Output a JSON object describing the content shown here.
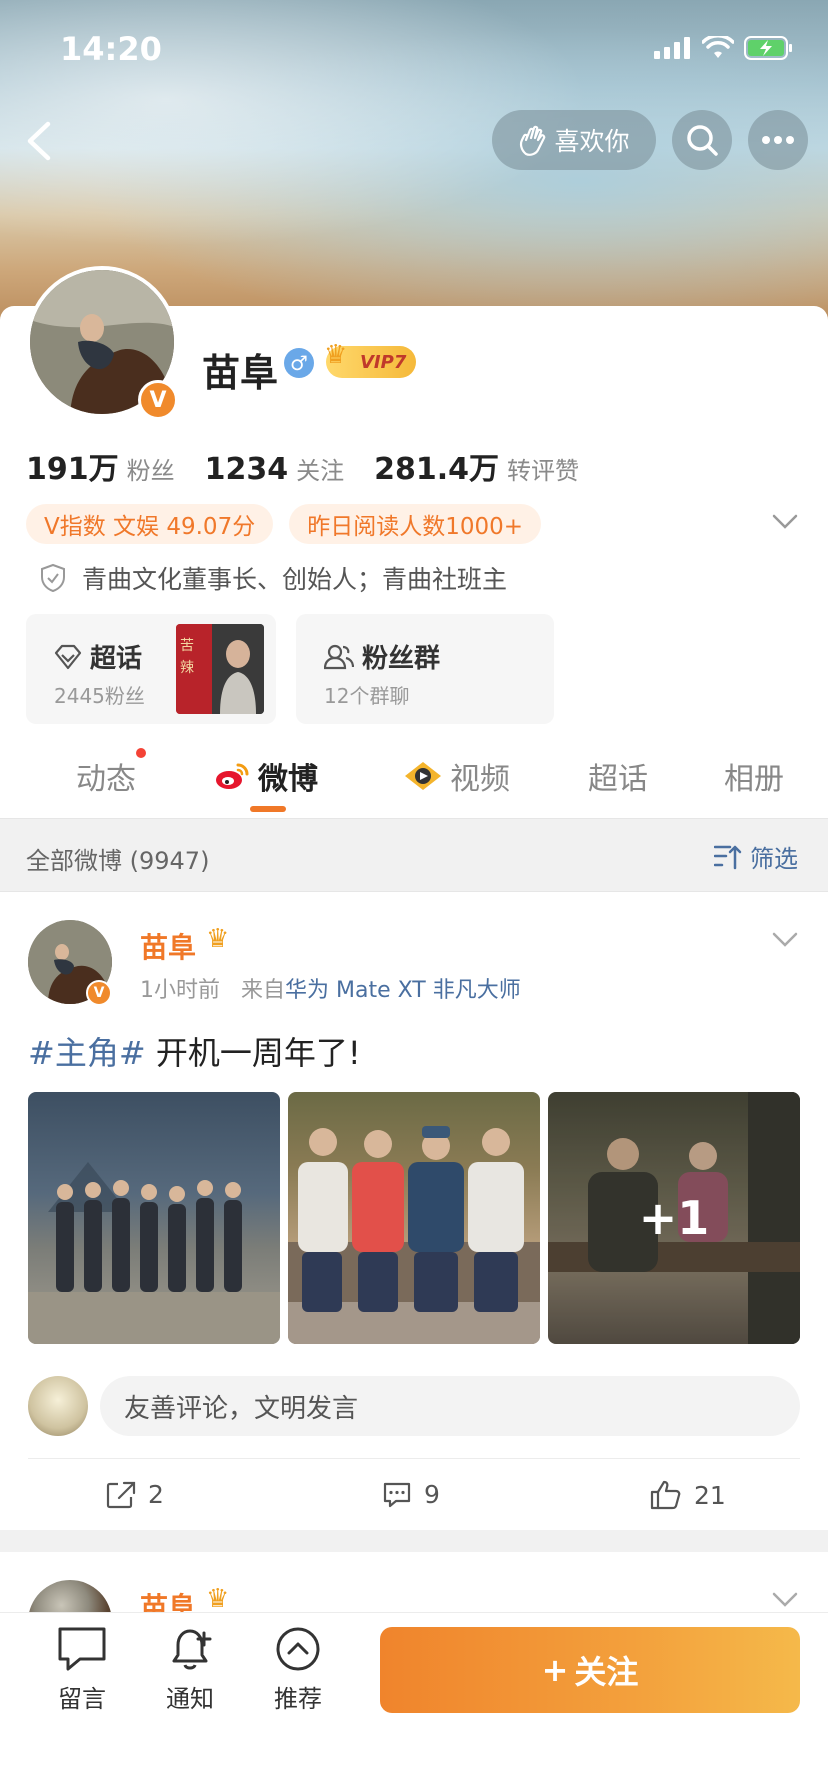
{
  "status": {
    "time": "14:20"
  },
  "header": {
    "like_label": "喜欢你"
  },
  "profile": {
    "name": "苗阜",
    "gender": "♂",
    "vip": "VIP7",
    "stats": [
      {
        "num": "191万",
        "label": "粉丝"
      },
      {
        "num": "1234",
        "label": "关注"
      },
      {
        "num": "281.4万",
        "label": "转评赞"
      }
    ],
    "tags": [
      "V指数 文娱 49.07分",
      "昨日阅读人数1000+"
    ],
    "bio": "青曲文化董事长、创始人；青曲社班主",
    "cards": {
      "supertopic": {
        "title": "超话",
        "sub": "2445粉丝"
      },
      "fangroup": {
        "title": "粉丝群",
        "sub": "12个群聊"
      }
    },
    "badge": "V"
  },
  "tabs": [
    "动态",
    "微博",
    "视频",
    "超话",
    "相册"
  ],
  "filter": {
    "left": "全部微博 (9947)",
    "right": "筛选"
  },
  "post": {
    "name": "苗阜",
    "time": "1小时前",
    "from": "来自",
    "source": "华为 Mate XT 非凡大师",
    "topic": "#主角#",
    "text": " 开机一周年了!",
    "more_photos": "+1",
    "comment_placeholder": "友善评论，文明发言",
    "reposts": "2",
    "comments": "9",
    "likes": "21"
  },
  "post2": {
    "name": "苗阜"
  },
  "bottom": {
    "message": "留言",
    "notify": "通知",
    "recommend": "推荐",
    "follow": "关注",
    "follow_plus": "+"
  },
  "colors": {
    "accent": "#f07828",
    "link": "#4a6fa0"
  }
}
